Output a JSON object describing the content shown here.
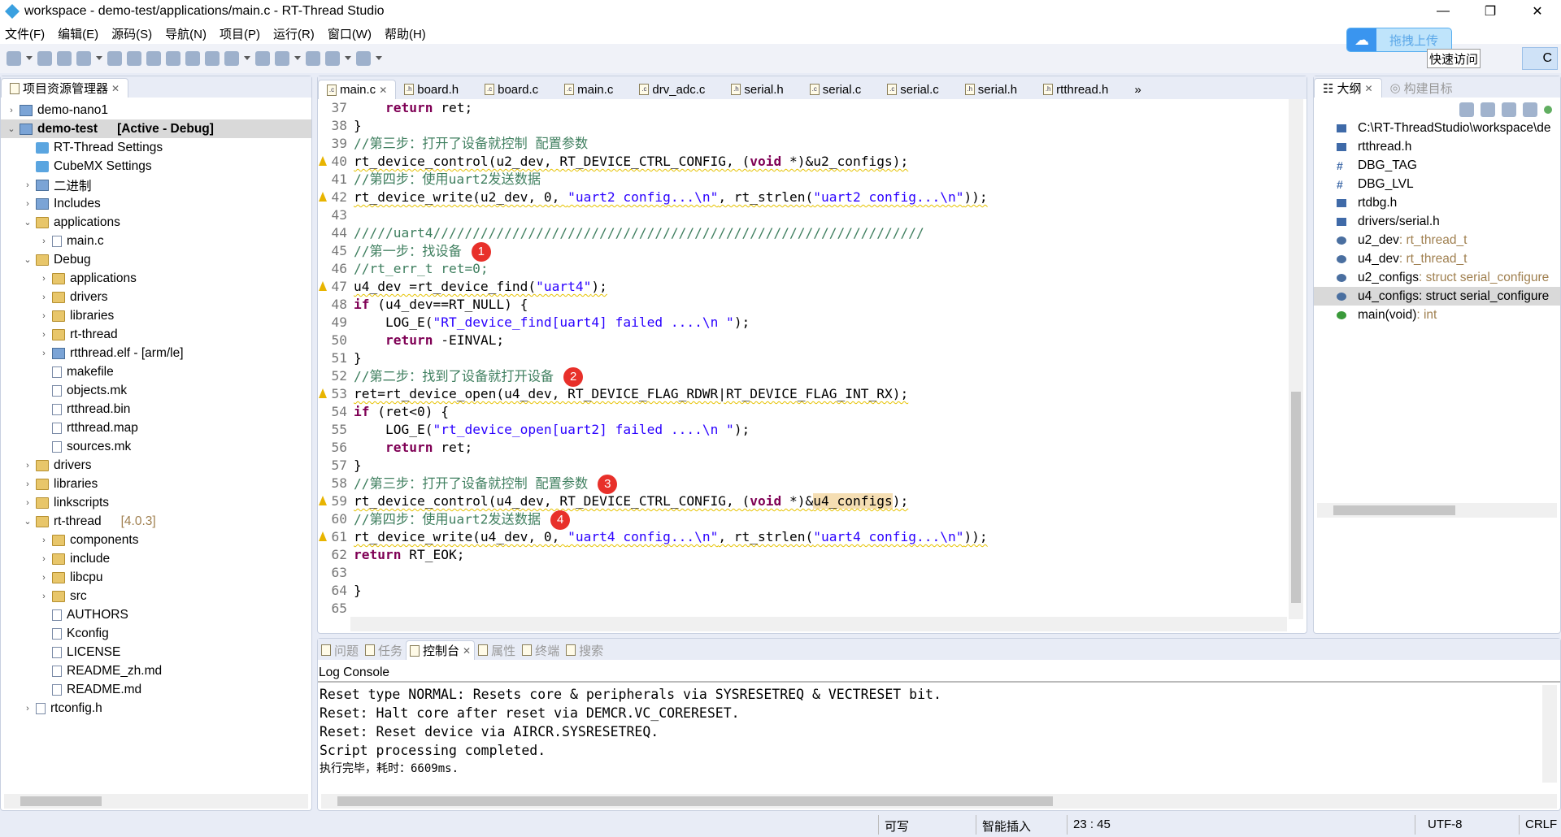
{
  "window": {
    "title": "workspace - demo-test/applications/main.c - RT-Thread Studio",
    "minimize": "—",
    "restore": "❐",
    "close": "✕"
  },
  "menu": [
    "文件(F)",
    "编辑(E)",
    "源码(S)",
    "导航(N)",
    "项目(P)",
    "运行(R)",
    "窗口(W)",
    "帮助(H)"
  ],
  "upload": {
    "label": "拖拽上传",
    "icon": "cloud-icon"
  },
  "quick_access": "快速访问",
  "perspective": "C",
  "project_explorer": {
    "title": "项目资源管理器",
    "tree": [
      {
        "label": "demo-nano1",
        "level": 0,
        "state": "collapsed",
        "icon": "project"
      },
      {
        "label": "demo-test",
        "suffix": "[Active - Debug]",
        "level": 0,
        "state": "expanded",
        "icon": "project",
        "selected": true,
        "bold": true
      },
      {
        "label": "RT-Thread Settings",
        "level": 1,
        "icon": "settings"
      },
      {
        "label": "CubeMX Settings",
        "level": 1,
        "icon": "settings"
      },
      {
        "label": "二进制",
        "level": 1,
        "state": "collapsed",
        "icon": "binary"
      },
      {
        "label": "Includes",
        "level": 1,
        "state": "collapsed",
        "icon": "includes"
      },
      {
        "label": "applications",
        "level": 1,
        "state": "expanded",
        "icon": "folder"
      },
      {
        "label": "main.c",
        "level": 2,
        "state": "collapsed",
        "icon": "file"
      },
      {
        "label": "Debug",
        "level": 1,
        "state": "expanded",
        "icon": "folder"
      },
      {
        "label": "applications",
        "level": 2,
        "state": "collapsed",
        "icon": "folder"
      },
      {
        "label": "drivers",
        "level": 2,
        "state": "collapsed",
        "icon": "folder"
      },
      {
        "label": "libraries",
        "level": 2,
        "state": "collapsed",
        "icon": "folder"
      },
      {
        "label": "rt-thread",
        "level": 2,
        "state": "collapsed",
        "icon": "folder"
      },
      {
        "label": "rtthread.elf - [arm/le]",
        "level": 2,
        "state": "collapsed",
        "icon": "binary"
      },
      {
        "label": "makefile",
        "level": 2,
        "icon": "file"
      },
      {
        "label": "objects.mk",
        "level": 2,
        "icon": "file"
      },
      {
        "label": "rtthread.bin",
        "level": 2,
        "icon": "file"
      },
      {
        "label": "rtthread.map",
        "level": 2,
        "icon": "file"
      },
      {
        "label": "sources.mk",
        "level": 2,
        "icon": "file"
      },
      {
        "label": "drivers",
        "level": 1,
        "state": "collapsed",
        "icon": "folder"
      },
      {
        "label": "libraries",
        "level": 1,
        "state": "collapsed",
        "icon": "folder"
      },
      {
        "label": "linkscripts",
        "level": 1,
        "state": "collapsed",
        "icon": "folder"
      },
      {
        "label": "rt-thread",
        "suffix": "[4.0.3]",
        "level": 1,
        "state": "expanded",
        "icon": "folder"
      },
      {
        "label": "components",
        "level": 2,
        "state": "collapsed",
        "icon": "folder"
      },
      {
        "label": "include",
        "level": 2,
        "state": "collapsed",
        "icon": "folder"
      },
      {
        "label": "libcpu",
        "level": 2,
        "state": "collapsed",
        "icon": "folder"
      },
      {
        "label": "src",
        "level": 2,
        "state": "collapsed",
        "icon": "folder"
      },
      {
        "label": "AUTHORS",
        "level": 2,
        "icon": "file"
      },
      {
        "label": "Kconfig",
        "level": 2,
        "icon": "file"
      },
      {
        "label": "LICENSE",
        "level": 2,
        "icon": "file"
      },
      {
        "label": "README_zh.md",
        "level": 2,
        "icon": "file"
      },
      {
        "label": "README.md",
        "level": 2,
        "icon": "file"
      },
      {
        "label": "rtconfig.h",
        "level": 1,
        "state": "collapsed",
        "icon": "file"
      }
    ]
  },
  "editor": {
    "tabs": [
      {
        "label": "main.c",
        "type": "c",
        "active": true
      },
      {
        "label": "board.h",
        "type": "h"
      },
      {
        "label": "board.c",
        "type": "c"
      },
      {
        "label": "main.c",
        "type": "c"
      },
      {
        "label": "drv_adc.c",
        "type": "c"
      },
      {
        "label": "serial.h",
        "type": "h"
      },
      {
        "label": "serial.c",
        "type": "c"
      },
      {
        "label": "serial.c",
        "type": "c"
      },
      {
        "label": "serial.h",
        "type": "h"
      },
      {
        "label": "rtthread.h",
        "type": "h"
      }
    ],
    "more_tabs": "»",
    "lines": [
      {
        "n": "37",
        "t": [
          [
            "p",
            "    "
          ],
          [
            "k",
            "return"
          ],
          [
            "p",
            " ret;"
          ]
        ]
      },
      {
        "n": "38",
        "t": [
          [
            "p",
            "}"
          ]
        ]
      },
      {
        "n": "39",
        "t": [
          [
            "c",
            "//第三步：打开了设备就控制 配置参数"
          ]
        ]
      },
      {
        "n": "40",
        "warn": true,
        "t": [
          [
            "p",
            "rt_device_control(u2_dev, RT_DEVICE_CTRL_CONFIG, ("
          ],
          [
            "k",
            "void"
          ],
          [
            "p",
            " *)&u2_configs);"
          ]
        ]
      },
      {
        "n": "41",
        "t": [
          [
            "c",
            "//第四步：使用uart2发送数据"
          ]
        ]
      },
      {
        "n": "42",
        "warn": true,
        "t": [
          [
            "p",
            "rt_device_write(u2_dev, 0, "
          ],
          [
            "s",
            "\"uart2 config...\\n\""
          ],
          [
            "p",
            ", rt_strlen("
          ],
          [
            "s",
            "\"uart2 config...\\n\""
          ],
          [
            "p",
            "));"
          ]
        ]
      },
      {
        "n": "43",
        "t": []
      },
      {
        "n": "44",
        "t": [
          [
            "c",
            "/////uart4//////////////////////////////////////////////////////////////"
          ]
        ]
      },
      {
        "n": "45",
        "badge": "1",
        "t": [
          [
            "c",
            "//第一步：找设备"
          ]
        ]
      },
      {
        "n": "46",
        "t": [
          [
            "c",
            "//rt_err_t ret=0;"
          ]
        ]
      },
      {
        "n": "47",
        "warn": true,
        "t": [
          [
            "p",
            "u4_dev =rt_device_find("
          ],
          [
            "s",
            "\"uart4\""
          ],
          [
            "p",
            ");"
          ]
        ]
      },
      {
        "n": "48",
        "t": [
          [
            "k",
            "if"
          ],
          [
            "p",
            " (u4_dev==RT_NULL) {"
          ]
        ]
      },
      {
        "n": "49",
        "t": [
          [
            "p",
            "    LOG_E("
          ],
          [
            "s",
            "\"RT_device_find[uart4] failed ....\\n \""
          ],
          [
            "p",
            ");"
          ]
        ]
      },
      {
        "n": "50",
        "t": [
          [
            "p",
            "    "
          ],
          [
            "k",
            "return"
          ],
          [
            "p",
            " -EINVAL;"
          ]
        ]
      },
      {
        "n": "51",
        "t": [
          [
            "p",
            "}"
          ]
        ]
      },
      {
        "n": "52",
        "badge": "2",
        "t": [
          [
            "c",
            "//第二步：找到了设备就打开设备"
          ]
        ]
      },
      {
        "n": "53",
        "warn": true,
        "t": [
          [
            "p",
            "ret=rt_device_open(u4_dev, RT_DEVICE_FLAG_RDWR|RT_DEVICE_FLAG_INT_RX);"
          ]
        ]
      },
      {
        "n": "54",
        "t": [
          [
            "k",
            "if"
          ],
          [
            "p",
            " (ret<0) {"
          ]
        ]
      },
      {
        "n": "55",
        "t": [
          [
            "p",
            "    LOG_E("
          ],
          [
            "s",
            "\"rt_device_open[uart2] failed ....\\n \""
          ],
          [
            "p",
            ");"
          ]
        ]
      },
      {
        "n": "56",
        "t": [
          [
            "p",
            "    "
          ],
          [
            "k",
            "return"
          ],
          [
            "p",
            " ret;"
          ]
        ]
      },
      {
        "n": "57",
        "t": [
          [
            "p",
            "}"
          ]
        ]
      },
      {
        "n": "58",
        "badge": "3",
        "t": [
          [
            "c",
            "//第三步：打开了设备就控制 配置参数"
          ]
        ]
      },
      {
        "n": "59",
        "warn": true,
        "t": [
          [
            "p",
            "rt_device_control(u4_dev, RT_DEVICE_CTRL_CONFIG, ("
          ],
          [
            "k",
            "void"
          ],
          [
            "p",
            " *)&"
          ],
          [
            "hl",
            "u4_configs"
          ],
          [
            "p",
            ");"
          ]
        ]
      },
      {
        "n": "60",
        "badge": "4",
        "t": [
          [
            "c",
            "//第四步：使用uart2发送数据"
          ]
        ]
      },
      {
        "n": "61",
        "warn": true,
        "t": [
          [
            "p",
            "rt_device_write(u4_dev, 0, "
          ],
          [
            "s",
            "\"uart4 config...\\n\""
          ],
          [
            "p",
            ", rt_strlen("
          ],
          [
            "s",
            "\"uart4 config...\\n\""
          ],
          [
            "p",
            "));"
          ]
        ]
      },
      {
        "n": "62",
        "t": [
          [
            "k",
            "return"
          ],
          [
            "p",
            " RT_EOK;"
          ]
        ]
      },
      {
        "n": "63",
        "t": []
      },
      {
        "n": "64",
        "t": [
          [
            "p",
            "}"
          ]
        ]
      },
      {
        "n": "65",
        "t": []
      }
    ]
  },
  "outline": {
    "tabs": [
      {
        "label": "大纲",
        "active": true
      },
      {
        "label": "构建目标"
      }
    ],
    "items": [
      {
        "label": "C:\\RT-ThreadStudio\\workspace\\de",
        "icon": "include"
      },
      {
        "label": "rtthread.h",
        "icon": "include"
      },
      {
        "label": "DBG_TAG",
        "icon": "macro"
      },
      {
        "label": "DBG_LVL",
        "icon": "macro"
      },
      {
        "label": "rtdbg.h",
        "icon": "include"
      },
      {
        "label": "drivers/serial.h",
        "icon": "include"
      },
      {
        "label": "u2_dev",
        "type": " : rt_thread_t",
        "icon": "variable"
      },
      {
        "label": "u4_dev",
        "type": " : rt_thread_t",
        "icon": "variable"
      },
      {
        "label": "u2_configs",
        "type": " : struct serial_configure",
        "icon": "variable"
      },
      {
        "label": "u4_configs",
        "type": " : struct serial_configure",
        "icon": "variable",
        "selected": true
      },
      {
        "label": "main(void)",
        "type": " : int",
        "icon": "function"
      }
    ]
  },
  "bottom": {
    "tabs": [
      {
        "label": "问题"
      },
      {
        "label": "任务"
      },
      {
        "label": "控制台",
        "active": true
      },
      {
        "label": "属性"
      },
      {
        "label": "终端"
      },
      {
        "label": "搜索"
      }
    ],
    "console_title": "Log Console",
    "lines": [
      "Reset type NORMAL: Resets core & peripherals via SYSRESETREQ & VECTRESET bit.",
      "Reset: Halt core after reset via DEMCR.VC_CORERESET.",
      "Reset: Reset device via AIRCR.SYSRESETREQ.",
      "Script processing completed."
    ],
    "final_line": "执行完毕，耗时：6609ms."
  },
  "status": {
    "writable": "可写",
    "insert_mode": "智能插入",
    "position": "23 : 45",
    "encoding": "UTF-8",
    "line_ending": "CRLF"
  }
}
